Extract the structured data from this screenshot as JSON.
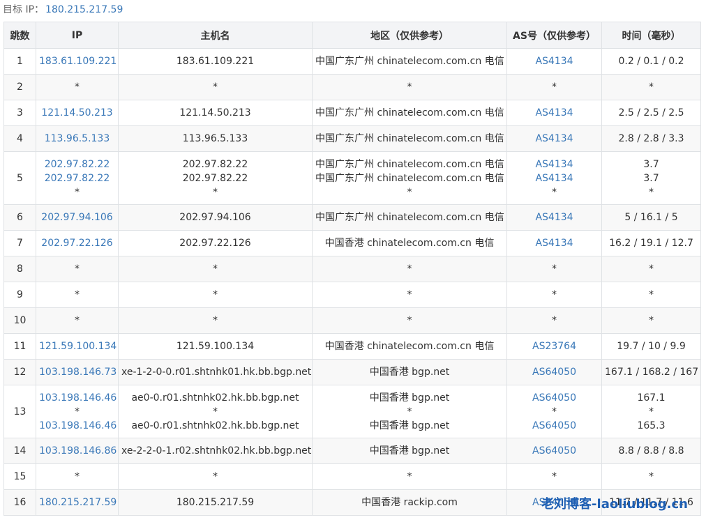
{
  "target": {
    "label": "目标 IP：",
    "ip": "180.215.217.59"
  },
  "columns": [
    "跳数",
    "IP",
    "主机名",
    "地区（仅供参考）",
    "AS号（仅供参考）",
    "时间（毫秒）"
  ],
  "rows": [
    {
      "hop": "1",
      "ips": [
        "183.61.109.221"
      ],
      "hosts": [
        "183.61.109.221"
      ],
      "regions": [
        "中国广东广州 chinatelecom.com.cn 电信"
      ],
      "asns": [
        "AS4134"
      ],
      "times": [
        "0.2 / 0.1 / 0.2"
      ]
    },
    {
      "hop": "2",
      "ips": [
        "*"
      ],
      "hosts": [
        "*"
      ],
      "regions": [
        "*"
      ],
      "asns": [
        "*"
      ],
      "times": [
        "*"
      ]
    },
    {
      "hop": "3",
      "ips": [
        "121.14.50.213"
      ],
      "hosts": [
        "121.14.50.213"
      ],
      "regions": [
        "中国广东广州 chinatelecom.com.cn 电信"
      ],
      "asns": [
        "AS4134"
      ],
      "times": [
        "2.5 / 2.5 / 2.5"
      ]
    },
    {
      "hop": "4",
      "ips": [
        "113.96.5.133"
      ],
      "hosts": [
        "113.96.5.133"
      ],
      "regions": [
        "中国广东广州 chinatelecom.com.cn 电信"
      ],
      "asns": [
        "AS4134"
      ],
      "times": [
        "2.8 / 2.8 / 3.3"
      ]
    },
    {
      "hop": "5",
      "ips": [
        "202.97.82.22",
        "202.97.82.22",
        "*"
      ],
      "hosts": [
        "202.97.82.22",
        "202.97.82.22",
        "*"
      ],
      "regions": [
        "中国广东广州 chinatelecom.com.cn 电信",
        "中国广东广州 chinatelecom.com.cn 电信",
        "*"
      ],
      "asns": [
        "AS4134",
        "AS4134",
        "*"
      ],
      "times": [
        "3.7",
        "3.7",
        "*"
      ]
    },
    {
      "hop": "6",
      "ips": [
        "202.97.94.106"
      ],
      "hosts": [
        "202.97.94.106"
      ],
      "regions": [
        "中国广东广州 chinatelecom.com.cn 电信"
      ],
      "asns": [
        "AS4134"
      ],
      "times": [
        "5 / 16.1 / 5"
      ]
    },
    {
      "hop": "7",
      "ips": [
        "202.97.22.126"
      ],
      "hosts": [
        "202.97.22.126"
      ],
      "regions": [
        "中国香港 chinatelecom.com.cn 电信"
      ],
      "asns": [
        "AS4134"
      ],
      "times": [
        "16.2 / 19.1 / 12.7"
      ]
    },
    {
      "hop": "8",
      "ips": [
        "*"
      ],
      "hosts": [
        "*"
      ],
      "regions": [
        "*"
      ],
      "asns": [
        "*"
      ],
      "times": [
        "*"
      ]
    },
    {
      "hop": "9",
      "ips": [
        "*"
      ],
      "hosts": [
        "*"
      ],
      "regions": [
        "*"
      ],
      "asns": [
        "*"
      ],
      "times": [
        "*"
      ]
    },
    {
      "hop": "10",
      "ips": [
        "*"
      ],
      "hosts": [
        "*"
      ],
      "regions": [
        "*"
      ],
      "asns": [
        "*"
      ],
      "times": [
        "*"
      ]
    },
    {
      "hop": "11",
      "ips": [
        "121.59.100.134"
      ],
      "hosts": [
        "121.59.100.134"
      ],
      "regions": [
        "中国香港 chinatelecom.com.cn 电信"
      ],
      "asns": [
        "AS23764"
      ],
      "times": [
        "19.7 / 10 / 9.9"
      ]
    },
    {
      "hop": "12",
      "ips": [
        "103.198.146.73"
      ],
      "hosts": [
        "xe-1-2-0-0.r01.shtnhk01.hk.bb.bgp.net"
      ],
      "regions": [
        "中国香港 bgp.net"
      ],
      "asns": [
        "AS64050"
      ],
      "times": [
        "167.1 / 168.2 / 167"
      ]
    },
    {
      "hop": "13",
      "ips": [
        "103.198.146.46",
        "*",
        "103.198.146.46"
      ],
      "hosts": [
        "ae0-0.r01.shtnhk02.hk.bb.bgp.net",
        "*",
        "ae0-0.r01.shtnhk02.hk.bb.bgp.net"
      ],
      "regions": [
        "中国香港 bgp.net",
        "*",
        "中国香港 bgp.net"
      ],
      "asns": [
        "AS64050",
        "*",
        "AS64050"
      ],
      "times": [
        "167.1",
        "*",
        "165.3"
      ]
    },
    {
      "hop": "14",
      "ips": [
        "103.198.146.86"
      ],
      "hosts": [
        "xe-2-2-0-1.r02.shtnhk02.hk.bb.bgp.net"
      ],
      "regions": [
        "中国香港 bgp.net"
      ],
      "asns": [
        "AS64050"
      ],
      "times": [
        "8.8 / 8.8 / 8.8"
      ]
    },
    {
      "hop": "15",
      "ips": [
        "*"
      ],
      "hosts": [
        "*"
      ],
      "regions": [
        "*"
      ],
      "asns": [
        "*"
      ],
      "times": [
        "*"
      ]
    },
    {
      "hop": "16",
      "ips": [
        "180.215.217.59"
      ],
      "hosts": [
        "180.215.217.59"
      ],
      "regions": [
        "中国香港 rackip.com"
      ],
      "asns": [
        "AS64050"
      ],
      "times": [
        "11.7 / 11.7 / 11.6"
      ]
    }
  ],
  "watermark": "老刘博客-laoliublog.cn"
}
